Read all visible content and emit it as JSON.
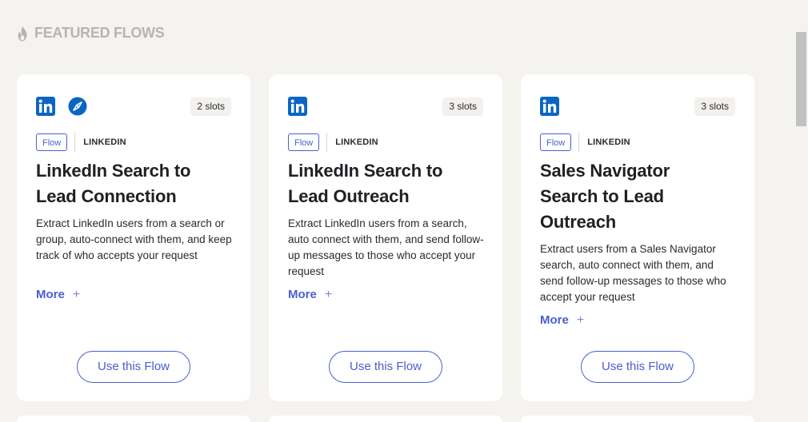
{
  "section": {
    "icon": "flame-icon",
    "title": "FEATURED FLOWS"
  },
  "colors": {
    "accent": "#4a5fd0",
    "linkedin": "#0a66c2",
    "background": "#f5f3f0",
    "card": "#ffffff",
    "muted_heading": "#b9b4ad"
  },
  "cards": [
    {
      "icons": [
        "linkedin-icon",
        "compass-icon"
      ],
      "slots": "2 slots",
      "tag": "Flow",
      "platform": "LINKEDIN",
      "title": "LinkedIn Search to Lead Connection",
      "description": "Extract LinkedIn users from a search or group, auto-connect with them, and keep track of who accepts your request",
      "more": "More",
      "button": "Use this Flow"
    },
    {
      "icons": [
        "linkedin-icon"
      ],
      "slots": "3 slots",
      "tag": "Flow",
      "platform": "LINKEDIN",
      "title": "LinkedIn Search to Lead Outreach",
      "description": "Extract LinkedIn users from a search, auto connect with them, and send follow-up messages to those who accept your request",
      "more": "More",
      "button": "Use this Flow"
    },
    {
      "icons": [
        "linkedin-icon"
      ],
      "slots": "3 slots",
      "tag": "Flow",
      "platform": "LINKEDIN",
      "title": "Sales Navigator Search to Lead Outreach",
      "description": "Extract users from a Sales Navigator search, auto connect with them, and send follow-up messages to those who accept your request",
      "more": "More",
      "button": "Use this Flow"
    }
  ]
}
